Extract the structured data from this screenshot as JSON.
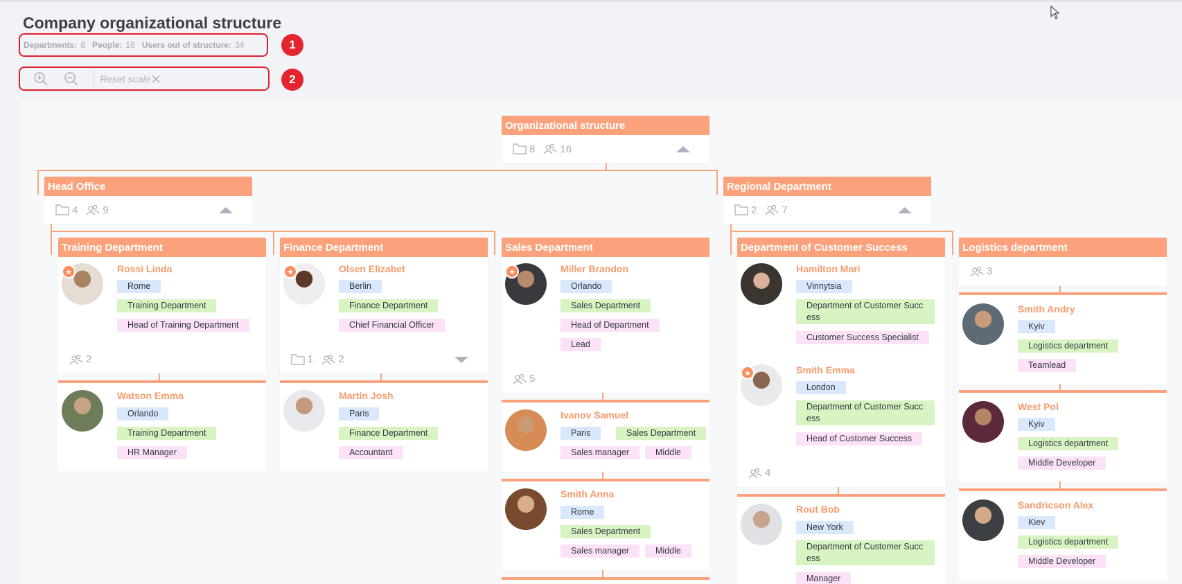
{
  "page": {
    "title": "Company organizational structure"
  },
  "stats": {
    "departments_label": "Departments:",
    "departments_value": "8",
    "people_label": "People:",
    "people_value": "16",
    "users_out_label": "Users out of structure:",
    "users_out_value": "34"
  },
  "toolbar": {
    "zoom_in_icon": "zoom-in-icon",
    "zoom_out_icon": "zoom-out-icon",
    "reset_label": "Reset scale",
    "reset_icon": "close-icon"
  },
  "annotations": {
    "badge1": "1",
    "badge2": "2",
    "color": "#e4242f"
  },
  "colors": {
    "header": "#fba17b",
    "name": "#f79a6a",
    "tag_city": "#d9e8fb",
    "tag_department": "#d8f4c3",
    "tag_position": "#fbe2f7"
  },
  "root": {
    "name": "Organizational structure",
    "departments": "8",
    "people": "16"
  },
  "head_office": {
    "name": "Head Office",
    "departments": "4",
    "people": "9"
  },
  "regional": {
    "name": "Regional Department",
    "departments": "2",
    "people": "7"
  },
  "training": {
    "name": "Training Department",
    "people": "2",
    "lead": {
      "name": "Rossi Linda",
      "city": "Rome",
      "department": "Training Department",
      "position": "Head of Training Department"
    },
    "members": [
      {
        "name": "Watson Emma",
        "city": "Orlando",
        "department": "Training Department",
        "position": "HR Manager"
      }
    ]
  },
  "finance": {
    "name": "Finance Department",
    "departments": "1",
    "people": "2",
    "lead": {
      "name": "Olsen Elizabet",
      "city": "Berlin",
      "department": "Finance Department",
      "position": "Chief Financial Officer"
    },
    "members": [
      {
        "name": "Martin Josh",
        "city": "Paris",
        "department": "Finance Department",
        "position": "Accountant"
      }
    ]
  },
  "sales": {
    "name": "Sales Department",
    "people": "5",
    "lead": {
      "name": "Miller Brandon",
      "city": "Orlando",
      "department": "Sales Department",
      "position": "Head of Department",
      "extra": "Lead"
    },
    "members": [
      {
        "name": "Ivanov Samuel",
        "city": "Paris",
        "department": "Sales Department",
        "position": "Sales manager",
        "level": "Middle"
      },
      {
        "name": "Smith Anna",
        "city": "Rome",
        "department": "Sales Department",
        "position": "Sales manager",
        "level": "Middle"
      }
    ]
  },
  "customer_success": {
    "name": "Department of Customer Success",
    "people": "4",
    "lead": {
      "name": "Hamilton Mari",
      "city": "Vinnytsia",
      "department": "Department of Customer Succ ess",
      "position": "Customer Success Specialist"
    },
    "lead2": {
      "name": "Smith Emma",
      "city": "London",
      "department": "Department of Customer Succ ess",
      "position": "Head of Customer Success"
    },
    "members": [
      {
        "name": "Rout Bob",
        "city": "New York",
        "department": "Department of Customer Succ ess",
        "position": "Manager"
      }
    ]
  },
  "logistics": {
    "name": "Logistics department",
    "people": "3",
    "members": [
      {
        "name": "Smith Andry",
        "city": "Kyiv",
        "department": "Logistics department",
        "position": "Teamlead"
      },
      {
        "name": "West Pol",
        "city": "Kyiv",
        "department": "Logistics department",
        "position": "Middle Developer"
      },
      {
        "name": "Sandricson Alex",
        "city": "Kiev",
        "department": "Logistics department",
        "position": "Middle Developer"
      }
    ]
  }
}
